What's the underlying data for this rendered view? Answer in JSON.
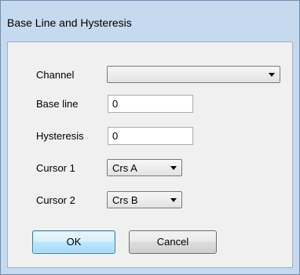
{
  "dialog": {
    "title": "Base Line and Hysteresis"
  },
  "form": {
    "channel": {
      "label": "Channel",
      "value": ""
    },
    "base_line": {
      "label": "Base line",
      "value": "0"
    },
    "hysteresis": {
      "label": "Hysteresis",
      "value": "0"
    },
    "cursor1": {
      "label": "Cursor 1",
      "value": "Crs A"
    },
    "cursor2": {
      "label": "Cursor 2",
      "value": "Crs B"
    }
  },
  "buttons": {
    "ok": "OK",
    "cancel": "Cancel"
  },
  "icons": {
    "dropdown": "chevron-down-icon"
  }
}
